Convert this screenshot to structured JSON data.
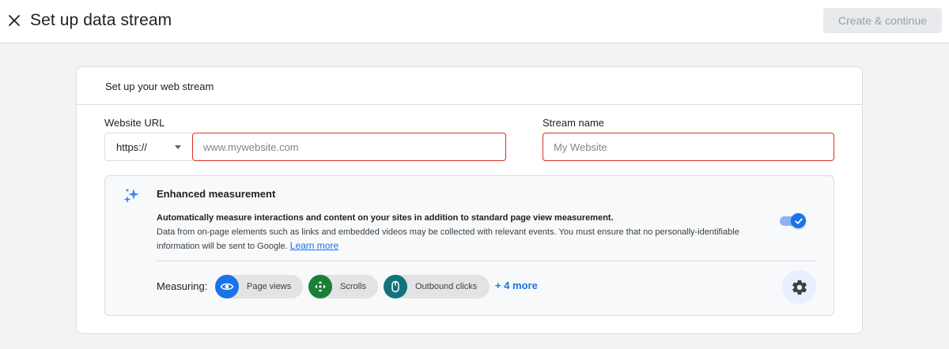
{
  "header": {
    "title": "Set up data stream",
    "primary_button": "Create & continue"
  },
  "card": {
    "title": "Set up your web stream",
    "url_label": "Website URL",
    "protocol_value": "https://",
    "url_placeholder": "www.mywebsite.com",
    "stream_label": "Stream name",
    "stream_placeholder": "My Website"
  },
  "enhanced": {
    "title": "Enhanced measurement",
    "bold_text": "Automatically measure interactions and content on your sites in addition to standard page view measurement.",
    "body_text": "Data from on-page elements such as links and embedded videos may be collected with relevant events. You must ensure that no personally-identifiable information will be sent to Google.",
    "learn_more": "Learn more",
    "toggle_on": true,
    "measuring_label": "Measuring:",
    "chips": [
      {
        "label": "Page views",
        "icon": "eye-icon",
        "color": "#1a73e8"
      },
      {
        "label": "Scrolls",
        "icon": "scroll-crosshair-icon",
        "color": "#188038"
      },
      {
        "label": "Outbound clicks",
        "icon": "mouse-icon",
        "color": "#12737b"
      }
    ],
    "more_link": "+ 4 more",
    "settings_icon": "gear-icon"
  },
  "colors": {
    "accent": "#1a73e8",
    "error_border": "#d93025",
    "disabled_button_bg": "#e8eaed"
  }
}
